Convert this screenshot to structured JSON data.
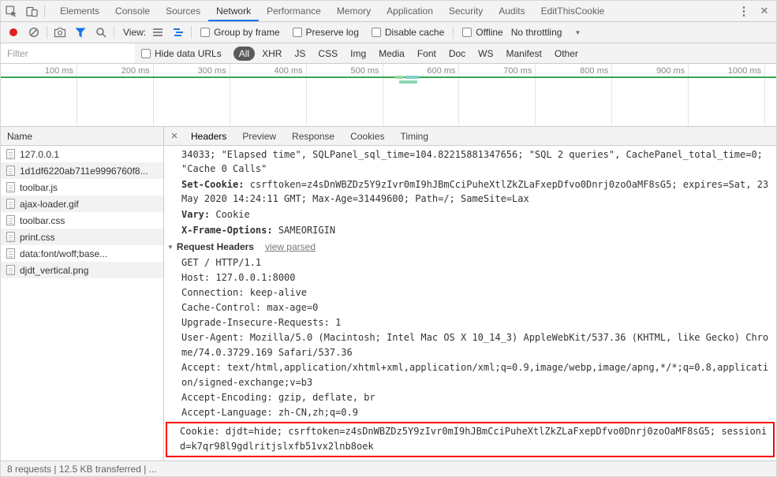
{
  "colors": {
    "accent_blue": "#1a73e8",
    "record_red": "#e02020",
    "highlight_red": "#ff0000",
    "timeline_green": "#34a853",
    "selected_filter_bg": "#5a5a5a"
  },
  "icons": {
    "inspect": "cursor-in-box",
    "device_toolbar": "devices",
    "more_options": "vertical-dots",
    "close": "x",
    "record": "red-circle",
    "clear": "circle-slash",
    "capture_screenshots": "camera",
    "filter": "funnel",
    "search": "magnifier",
    "list_view": "rows",
    "overview_view": "waterfall-bars",
    "throttling_caret": "chevron-down",
    "disclosure": "triangle-down"
  },
  "tabbar": {
    "tabs": [
      "Elements",
      "Console",
      "Sources",
      "Network",
      "Performance",
      "Memory",
      "Application",
      "Security",
      "Audits",
      "EditThisCookie"
    ],
    "active_tab": "Network"
  },
  "toolbar": {
    "view_label": "View:",
    "checkbox_group_by_frame": "Group by frame",
    "checkbox_preserve_log": "Preserve log",
    "checkbox_disable_cache": "Disable cache",
    "checkbox_offline": "Offline",
    "throttling_value": "No throttling"
  },
  "filter_bar": {
    "filter_placeholder": "Filter",
    "hide_data_urls_label": "Hide data URLs",
    "types": [
      "All",
      "XHR",
      "JS",
      "CSS",
      "Img",
      "Media",
      "Font",
      "Doc",
      "WS",
      "Manifest",
      "Other"
    ],
    "active_type": "All"
  },
  "overview": {
    "ticks": [
      "100 ms",
      "200 ms",
      "300 ms",
      "400 ms",
      "500 ms",
      "600 ms",
      "700 ms",
      "800 ms",
      "900 ms",
      "1000 ms"
    ]
  },
  "request_list": {
    "header": "Name",
    "items": [
      {
        "name": "127.0.0.1",
        "type": "document"
      },
      {
        "name": "1d1df6220ab711e9996760f8...",
        "type": "xhr"
      },
      {
        "name": "toolbar.js",
        "type": "script"
      },
      {
        "name": "ajax-loader.gif",
        "type": "image"
      },
      {
        "name": "toolbar.css",
        "type": "stylesheet"
      },
      {
        "name": "print.css",
        "type": "stylesheet"
      },
      {
        "name": "data:font/woff;base...",
        "type": "font"
      },
      {
        "name": "djdt_vertical.png",
        "type": "image"
      }
    ]
  },
  "details": {
    "tabs": [
      "Headers",
      "Preview",
      "Response",
      "Cookies",
      "Timing"
    ],
    "active_tab": "Headers",
    "response_headers": [
      {
        "name": "",
        "value": "34033; \"Elapsed time\", SQLPanel_sql_time=104.82215881347656; \"SQL 2 queries\", CachePanel_total_time=0; \"Cache 0 Calls\""
      },
      {
        "name": "Set-Cookie:",
        "value": "csrftoken=z4sDnWBZDz5Y9zIvr0mI9hJBmCciPuheXtlZkZLaFxepDfvo0Dnrj0zoOaMF8sG5; expires=Sat, 23 May 2020 14:24:11 GMT; Max-Age=31449600; Path=/; SameSite=Lax"
      },
      {
        "name": "Vary:",
        "value": "Cookie"
      },
      {
        "name": "X-Frame-Options:",
        "value": "SAMEORIGIN"
      }
    ],
    "request_headers_title": "Request Headers",
    "view_parsed_label": "view parsed",
    "request_header_lines": [
      "GET / HTTP/1.1",
      "Host: 127.0.0.1:8000",
      "Connection: keep-alive",
      "Cache-Control: max-age=0",
      "Upgrade-Insecure-Requests: 1",
      "User-Agent: Mozilla/5.0 (Macintosh; Intel Mac OS X 10_14_3) AppleWebKit/537.36 (KHTML, like Gecko) Chrome/74.0.3729.169 Safari/537.36",
      "Accept: text/html,application/xhtml+xml,application/xml;q=0.9,image/webp,image/apng,*/*;q=0.8,application/signed-exchange;v=b3",
      "Accept-Encoding: gzip, deflate, br",
      "Accept-Language: zh-CN,zh;q=0.9"
    ],
    "cookie_line": "Cookie: djdt=hide; csrftoken=z4sDnWBZDz5Y9zIvr0mI9hJBmCciPuheXtlZkZLaFxepDfvo0Dnrj0zoOaMF8sG5; sessionid=k7qr98l9gdlritjslxfb51vx2lnb8oek"
  },
  "status_bar": {
    "summary": "8 requests | 12.5 KB transferred | ..."
  }
}
